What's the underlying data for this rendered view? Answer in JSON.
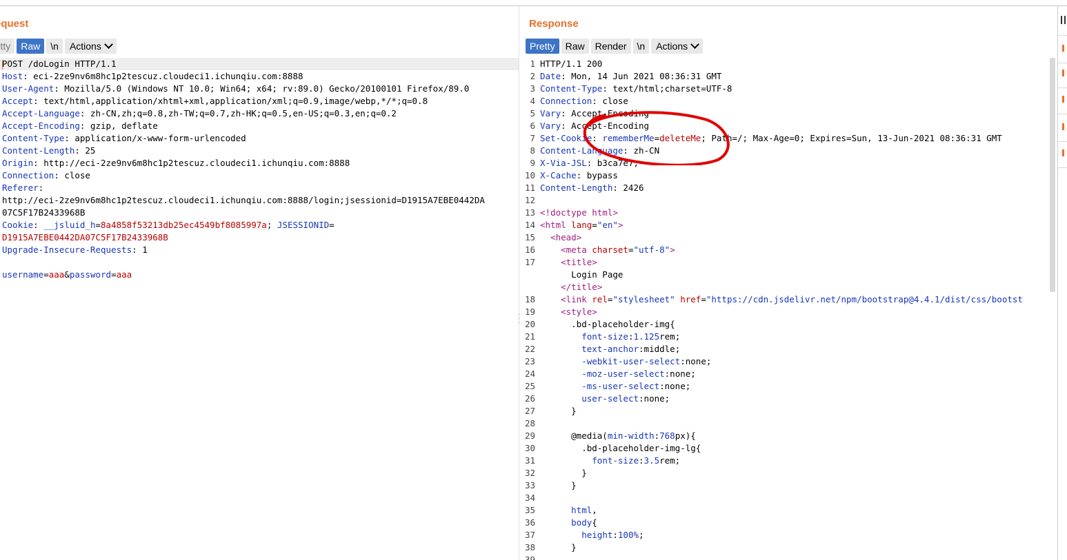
{
  "request": {
    "title": "equest",
    "tabs": [
      "retty",
      "Raw",
      "\\n"
    ],
    "active_tab": "Raw",
    "actions_label": "Actions",
    "lines": [
      [
        {
          "t": "POST /doLogin HTTP/1.1",
          "c": ""
        }
      ],
      [
        {
          "t": "Host",
          "c": "k"
        },
        {
          "t": ": eci-2ze9nv6m8hc1p2tescuz.cloudeci1.ichunqiu.com:8888",
          "c": ""
        }
      ],
      [
        {
          "t": "User-Agent",
          "c": "k"
        },
        {
          "t": ": Mozilla/5.0 (Windows NT 10.0; Win64; x64; rv:89.0) Gecko/20100101 Firefox/89.0",
          "c": ""
        }
      ],
      [
        {
          "t": "Accept",
          "c": "k"
        },
        {
          "t": ": text/html,application/xhtml+xml,application/xml;q=0.9,image/webp,*/*;q=0.8",
          "c": ""
        }
      ],
      [
        {
          "t": "Accept-Language",
          "c": "k"
        },
        {
          "t": ": zh-CN,zh;q=0.8,zh-TW;q=0.7,zh-HK;q=0.5,en-US;q=0.3,en;q=0.2",
          "c": ""
        }
      ],
      [
        {
          "t": "Accept-Encoding",
          "c": "k"
        },
        {
          "t": ": gzip, deflate",
          "c": ""
        }
      ],
      [
        {
          "t": "Content-Type",
          "c": "k"
        },
        {
          "t": ": application/x-www-form-urlencoded",
          "c": ""
        }
      ],
      [
        {
          "t": "Content-Length",
          "c": "k"
        },
        {
          "t": ": 25",
          "c": ""
        }
      ],
      [
        {
          "t": "Origin",
          "c": "k"
        },
        {
          "t": ": http://eci-2ze9nv6m8hc1p2tescuz.cloudeci1.ichunqiu.com:8888",
          "c": ""
        }
      ],
      [
        {
          "t": "Connection",
          "c": "k"
        },
        {
          "t": ": close",
          "c": ""
        }
      ],
      [
        {
          "t": "Referer",
          "c": "k"
        },
        {
          "t": ":",
          "c": ""
        }
      ],
      [
        {
          "t": "http://eci-2ze9nv6m8hc1p2tescuz.cloudeci1.ichunqiu.com:8888/login;jsessionid=D1915A7EBE0442DA",
          "c": ""
        }
      ],
      [
        {
          "t": "07C5F17B2433968B",
          "c": ""
        }
      ],
      [
        {
          "t": "Cookie",
          "c": "k"
        },
        {
          "t": ": ",
          "c": ""
        },
        {
          "t": "__jsluid_h",
          "c": "k"
        },
        {
          "t": "=",
          "c": ""
        },
        {
          "t": "8a4858f53213db25ec4549bf8085997a",
          "c": "r"
        },
        {
          "t": "; ",
          "c": ""
        },
        {
          "t": "JSESSIONID",
          "c": "k"
        },
        {
          "t": "=",
          "c": ""
        }
      ],
      [
        {
          "t": "D1915A7EBE0442DA07C5F17B2433968B",
          "c": "r"
        }
      ],
      [
        {
          "t": "Upgrade-Insecure-Requests",
          "c": "k"
        },
        {
          "t": ": 1",
          "c": ""
        }
      ],
      [
        {
          "t": "",
          "c": ""
        }
      ],
      [
        {
          "t": "username",
          "c": "k"
        },
        {
          "t": "=",
          "c": ""
        },
        {
          "t": "aaa",
          "c": "r"
        },
        {
          "t": "&",
          "c": ""
        },
        {
          "t": "password",
          "c": "k"
        },
        {
          "t": "=",
          "c": ""
        },
        {
          "t": "aaa",
          "c": "r"
        }
      ]
    ]
  },
  "response": {
    "title": "Response",
    "tabs": [
      "Pretty",
      "Raw",
      "Render",
      "\\n"
    ],
    "active_tab": "Pretty",
    "actions_label": "Actions",
    "lines": [
      {
        "n": "1",
        "s": [
          {
            "t": "HTTP/1.1 200",
            "c": ""
          }
        ]
      },
      {
        "n": "2",
        "s": [
          {
            "t": "Date",
            "c": "k"
          },
          {
            "t": ": Mon, 14 Jun 2021 08:36:31 GMT",
            "c": ""
          }
        ]
      },
      {
        "n": "3",
        "s": [
          {
            "t": "Content-Type",
            "c": "k"
          },
          {
            "t": ": text/html;charset=UTF-8",
            "c": ""
          }
        ]
      },
      {
        "n": "4",
        "s": [
          {
            "t": "Connection",
            "c": "k"
          },
          {
            "t": ": close",
            "c": ""
          }
        ]
      },
      {
        "n": "5",
        "s": [
          {
            "t": "Vary",
            "c": "k"
          },
          {
            "t": ": Accept-Encoding",
            "c": ""
          }
        ]
      },
      {
        "n": "6",
        "s": [
          {
            "t": "Vary",
            "c": "k"
          },
          {
            "t": ": Accept-Encoding",
            "c": ""
          }
        ]
      },
      {
        "n": "7",
        "s": [
          {
            "t": "Set-Cookie",
            "c": "k"
          },
          {
            "t": ": ",
            "c": ""
          },
          {
            "t": "rememberMe",
            "c": "k"
          },
          {
            "t": "=",
            "c": ""
          },
          {
            "t": "deleteMe",
            "c": "r"
          },
          {
            "t": "; Path=/; Max-Age=0; Expires=Sun, 13-Jun-2021 08:36:31 GMT",
            "c": ""
          }
        ]
      },
      {
        "n": "8",
        "s": [
          {
            "t": "Content-Language",
            "c": "k"
          },
          {
            "t": ": zh-CN",
            "c": ""
          }
        ]
      },
      {
        "n": "9",
        "s": [
          {
            "t": "X-Via-JSL",
            "c": "k"
          },
          {
            "t": ": b3ca7e7,-",
            "c": ""
          }
        ]
      },
      {
        "n": "10",
        "s": [
          {
            "t": "X-Cache",
            "c": "k"
          },
          {
            "t": ": bypass",
            "c": ""
          }
        ]
      },
      {
        "n": "11",
        "s": [
          {
            "t": "Content-Length",
            "c": "k"
          },
          {
            "t": ": 2426",
            "c": ""
          }
        ]
      },
      {
        "n": "12",
        "s": []
      },
      {
        "n": "13",
        "s": [
          {
            "t": "<!doctype html>",
            "c": "tag"
          }
        ]
      },
      {
        "n": "14",
        "s": [
          {
            "t": "<html ",
            "c": "tag"
          },
          {
            "t": "lang",
            "c": "attr"
          },
          {
            "t": "=",
            "c": ""
          },
          {
            "t": "\"en\"",
            "c": "str"
          },
          {
            "t": ">",
            "c": "tag"
          }
        ]
      },
      {
        "n": "15",
        "s": [
          {
            "t": "  ",
            "c": ""
          },
          {
            "t": "<head>",
            "c": "tag"
          }
        ]
      },
      {
        "n": "16",
        "s": [
          {
            "t": "    ",
            "c": ""
          },
          {
            "t": "<meta ",
            "c": "tag"
          },
          {
            "t": "charset",
            "c": "attr"
          },
          {
            "t": "=",
            "c": ""
          },
          {
            "t": "\"utf-8\"",
            "c": "str"
          },
          {
            "t": ">",
            "c": "tag"
          }
        ]
      },
      {
        "n": "17",
        "s": [
          {
            "t": "    ",
            "c": ""
          },
          {
            "t": "<title>",
            "c": "tag"
          }
        ]
      },
      {
        "n": "",
        "s": [
          {
            "t": "      Login Page",
            "c": ""
          }
        ]
      },
      {
        "n": "",
        "s": [
          {
            "t": "    ",
            "c": ""
          },
          {
            "t": "</title>",
            "c": "tag"
          }
        ]
      },
      {
        "n": "18",
        "s": [
          {
            "t": "    ",
            "c": ""
          },
          {
            "t": "<link ",
            "c": "tag"
          },
          {
            "t": "rel",
            "c": "attr"
          },
          {
            "t": "=",
            "c": ""
          },
          {
            "t": "\"stylesheet\" ",
            "c": "str"
          },
          {
            "t": "href",
            "c": "attr"
          },
          {
            "t": "=",
            "c": ""
          },
          {
            "t": "\"https://cdn.jsdelivr.net/npm/bootstrap@4.4.1/dist/css/bootst",
            "c": "str"
          }
        ]
      },
      {
        "n": "19",
        "s": [
          {
            "t": "    ",
            "c": ""
          },
          {
            "t": "<style>",
            "c": "tag"
          }
        ]
      },
      {
        "n": "20",
        "s": [
          {
            "t": "      .bd-placeholder-img{",
            "c": ""
          }
        ]
      },
      {
        "n": "21",
        "s": [
          {
            "t": "        ",
            "c": ""
          },
          {
            "t": "font-size",
            "c": "prop"
          },
          {
            "t": ":",
            "c": ""
          },
          {
            "t": "1.125",
            "c": "num"
          },
          {
            "t": "rem;",
            "c": ""
          }
        ]
      },
      {
        "n": "22",
        "s": [
          {
            "t": "        ",
            "c": ""
          },
          {
            "t": "text-anchor",
            "c": "prop"
          },
          {
            "t": ":middle;",
            "c": ""
          }
        ]
      },
      {
        "n": "23",
        "s": [
          {
            "t": "        ",
            "c": ""
          },
          {
            "t": "-webkit-user-select",
            "c": "prop"
          },
          {
            "t": ":none;",
            "c": ""
          }
        ]
      },
      {
        "n": "24",
        "s": [
          {
            "t": "        ",
            "c": ""
          },
          {
            "t": "-moz-user-select",
            "c": "prop"
          },
          {
            "t": ":none;",
            "c": ""
          }
        ]
      },
      {
        "n": "25",
        "s": [
          {
            "t": "        ",
            "c": ""
          },
          {
            "t": "-ms-user-select",
            "c": "prop"
          },
          {
            "t": ":none;",
            "c": ""
          }
        ]
      },
      {
        "n": "26",
        "s": [
          {
            "t": "        ",
            "c": ""
          },
          {
            "t": "user-select",
            "c": "prop"
          },
          {
            "t": ":none;",
            "c": ""
          }
        ]
      },
      {
        "n": "27",
        "s": [
          {
            "t": "      }",
            "c": ""
          }
        ]
      },
      {
        "n": "28",
        "s": []
      },
      {
        "n": "29",
        "s": [
          {
            "t": "      @media(",
            "c": ""
          },
          {
            "t": "min-width",
            "c": "prop"
          },
          {
            "t": ":",
            "c": ""
          },
          {
            "t": "768",
            "c": "num"
          },
          {
            "t": "px){",
            "c": ""
          }
        ]
      },
      {
        "n": "30",
        "s": [
          {
            "t": "        .bd-placeholder-img-lg{",
            "c": ""
          }
        ]
      },
      {
        "n": "31",
        "s": [
          {
            "t": "          ",
            "c": ""
          },
          {
            "t": "font-size",
            "c": "prop"
          },
          {
            "t": ":",
            "c": ""
          },
          {
            "t": "3.5",
            "c": "num"
          },
          {
            "t": "rem;",
            "c": ""
          }
        ]
      },
      {
        "n": "32",
        "s": [
          {
            "t": "        }",
            "c": ""
          }
        ]
      },
      {
        "n": "33",
        "s": [
          {
            "t": "      }",
            "c": ""
          }
        ]
      },
      {
        "n": "34",
        "s": []
      },
      {
        "n": "35",
        "s": [
          {
            "t": "      ",
            "c": ""
          },
          {
            "t": "html",
            "c": "prop"
          },
          {
            "t": ",",
            "c": ""
          }
        ]
      },
      {
        "n": "36",
        "s": [
          {
            "t": "      ",
            "c": ""
          },
          {
            "t": "body",
            "c": "prop"
          },
          {
            "t": "{",
            "c": ""
          }
        ]
      },
      {
        "n": "37",
        "s": [
          {
            "t": "        ",
            "c": ""
          },
          {
            "t": "height",
            "c": "prop"
          },
          {
            "t": ":",
            "c": ""
          },
          {
            "t": "100%",
            "c": "num"
          },
          {
            "t": ";",
            "c": ""
          }
        ]
      },
      {
        "n": "38",
        "s": [
          {
            "t": "      }",
            "c": ""
          }
        ]
      },
      {
        "n": "39",
        "s": []
      }
    ]
  },
  "view_toggles": [
    {
      "name": "split-view-icon",
      "active": true
    },
    {
      "name": "horizontal-view-icon",
      "active": false
    },
    {
      "name": "single-view-icon",
      "active": false
    }
  ],
  "annotation_color": "#e00000",
  "accent_color": "#e8702a",
  "active_tab_color": "#3d74c6"
}
